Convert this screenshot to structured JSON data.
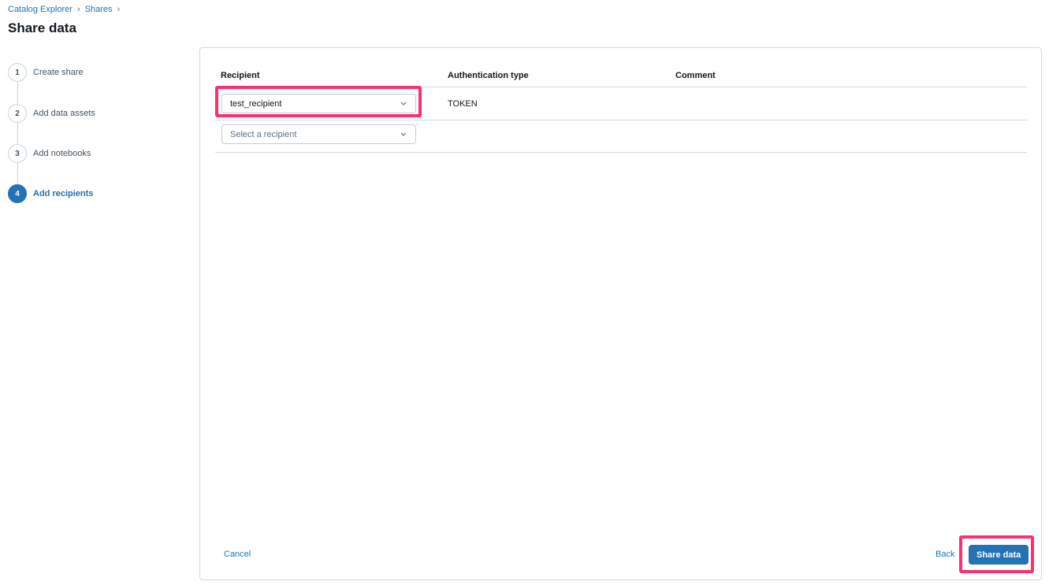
{
  "breadcrumb": {
    "items": [
      "Catalog Explorer",
      "Shares"
    ],
    "separator": "›"
  },
  "page_title": "Share data",
  "steps": [
    {
      "number": "1",
      "label": "Create share",
      "active": false
    },
    {
      "number": "2",
      "label": "Add data assets",
      "active": false
    },
    {
      "number": "3",
      "label": "Add notebooks",
      "active": false
    },
    {
      "number": "4",
      "label": "Add recipients",
      "active": true
    }
  ],
  "table": {
    "columns": [
      "Recipient",
      "Authentication type",
      "Comment"
    ],
    "rows": [
      {
        "recipient": "test_recipient",
        "auth_type": "TOKEN",
        "comment": ""
      }
    ],
    "new_row_placeholder": "Select a recipient"
  },
  "footer": {
    "cancel_label": "Cancel",
    "back_label": "Back",
    "submit_label": "Share data"
  },
  "colors": {
    "accent": "#2272b4",
    "highlight": "#ff2e6d",
    "border": "#d1d9e1"
  },
  "icons": {
    "dropdown": "chevron-down-icon",
    "breadcrumb_separator": "chevron-right-icon"
  }
}
